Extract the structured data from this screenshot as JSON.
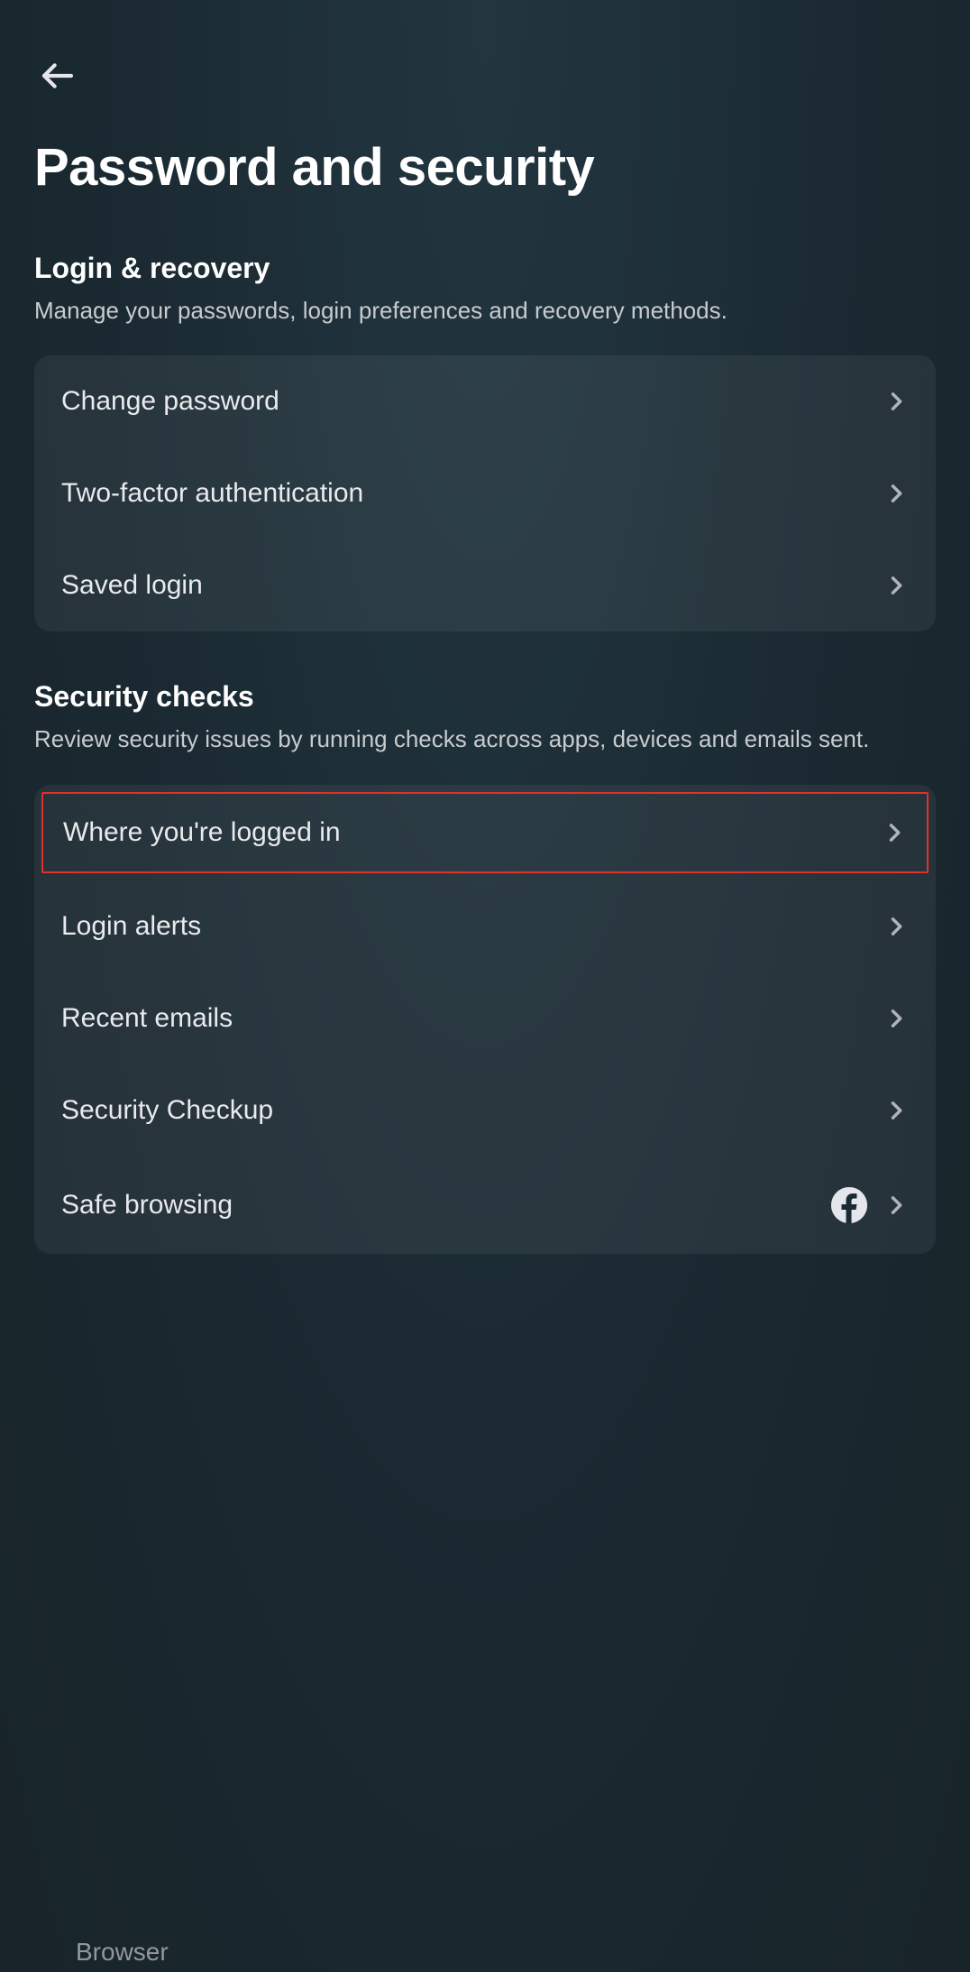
{
  "header": {
    "title": "Password and security"
  },
  "sections": [
    {
      "title": "Login & recovery",
      "desc": "Manage your passwords, login preferences and recovery methods.",
      "items": [
        {
          "label": "Change password"
        },
        {
          "label": "Two-factor authentication"
        },
        {
          "label": "Saved login"
        }
      ]
    },
    {
      "title": "Security checks",
      "desc": "Review security issues by running checks across apps, devices and emails sent.",
      "items": [
        {
          "label": "Where you're logged in"
        },
        {
          "label": "Login alerts"
        },
        {
          "label": "Recent emails"
        },
        {
          "label": "Security Checkup"
        },
        {
          "label": "Safe browsing"
        }
      ]
    }
  ],
  "peek": "Browser"
}
